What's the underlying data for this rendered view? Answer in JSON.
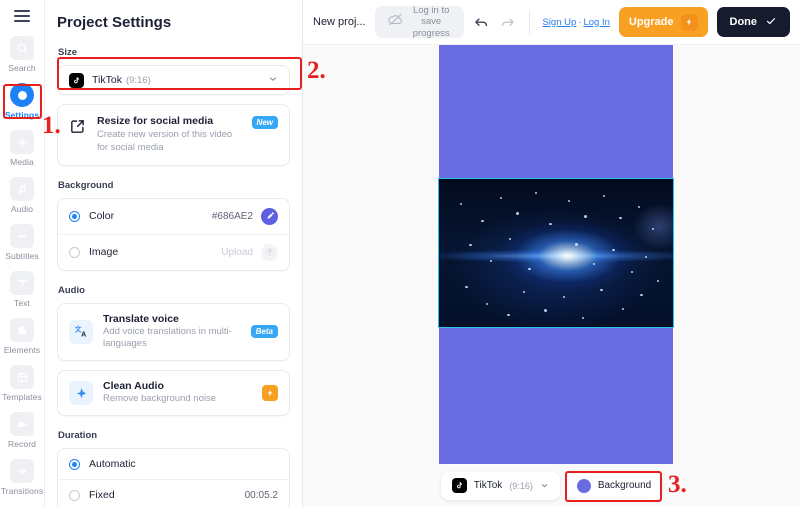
{
  "colors": {
    "accent_blue": "#1d82f5",
    "background_purple": "#686AE2",
    "upgrade_orange": "#F8A022",
    "done_dark": "#161B2E",
    "annotation_red": "#E81F1F",
    "badge_blue": "#36A7F5"
  },
  "rail": {
    "menu_icon": "hamburger-icon",
    "items": [
      {
        "label": "Search",
        "icon": "search-icon"
      },
      {
        "label": "Settings",
        "icon": "settings-ring-icon"
      },
      {
        "label": "Media",
        "icon": "plus-icon"
      },
      {
        "label": "Audio",
        "icon": "music-note-icon"
      },
      {
        "label": "Subtitles",
        "icon": "subtitles-icon"
      },
      {
        "label": "Text",
        "icon": "text-t-icon"
      },
      {
        "label": "Elements",
        "icon": "elements-icon"
      },
      {
        "label": "Templates",
        "icon": "templates-icon"
      },
      {
        "label": "Record",
        "icon": "video-camera-icon"
      },
      {
        "label": "Transitions",
        "icon": "transitions-icon"
      }
    ],
    "active": "Settings"
  },
  "panel": {
    "title": "Project Settings",
    "size": {
      "label": "Size",
      "selected_name": "TikTok",
      "selected_ratio": "(9:16)",
      "chevron": "chevron-down-icon",
      "platform_icon": "tiktok-icon"
    },
    "resize": {
      "icon": "external-link-icon",
      "title": "Resize for social media",
      "subtitle": "Create new version of this video for social media",
      "badge": "New"
    },
    "background": {
      "label": "Background",
      "color_row": {
        "label": "Color",
        "value": "#686AE2",
        "selected": true,
        "swatch_icon": "eyedropper-icon"
      },
      "image_row": {
        "label": "Image",
        "value": "Upload",
        "selected": false,
        "swatch_icon": "upload-icon"
      }
    },
    "audio": {
      "label": "Audio",
      "items": [
        {
          "icon": "translate-icon",
          "title": "Translate voice",
          "subtitle": "Add voice translations in multi-languages",
          "badge": "Beta"
        },
        {
          "icon": "sparkle-icon",
          "title": "Clean Audio",
          "subtitle": "Remove background noise",
          "badge": "bolt-icon"
        }
      ]
    },
    "duration": {
      "label": "Duration",
      "automatic": {
        "label": "Automatic",
        "selected": true
      },
      "fixed": {
        "label": "Fixed",
        "value": "00:05.2",
        "selected": false
      }
    }
  },
  "topbar": {
    "project_name": "New proj...",
    "save_pill": {
      "icon": "cloud-off-icon",
      "text": "Log in to save progress"
    },
    "undo_icon": "undo-arrow-icon",
    "redo_icon": "redo-arrow-icon",
    "sign_up": "Sign Up",
    "separator": "·",
    "log_in": "Log In",
    "upgrade": {
      "label": "Upgrade",
      "icon": "bolt-icon"
    },
    "done": {
      "label": "Done",
      "icon": "check-icon"
    }
  },
  "stage": {
    "canvas_background": "#686AE2",
    "video_clip_name": "blue-light-burst-video"
  },
  "bottombar": {
    "size_pill": {
      "icon": "tiktok-icon",
      "name": "TikTok",
      "ratio": "(9:16)",
      "chevron": "chevron-down-icon"
    },
    "background_pill": {
      "label": "Background",
      "dot_color": "#686AE2"
    }
  },
  "annotations": [
    {
      "number": "1."
    },
    {
      "number": "2."
    },
    {
      "number": "3."
    }
  ]
}
